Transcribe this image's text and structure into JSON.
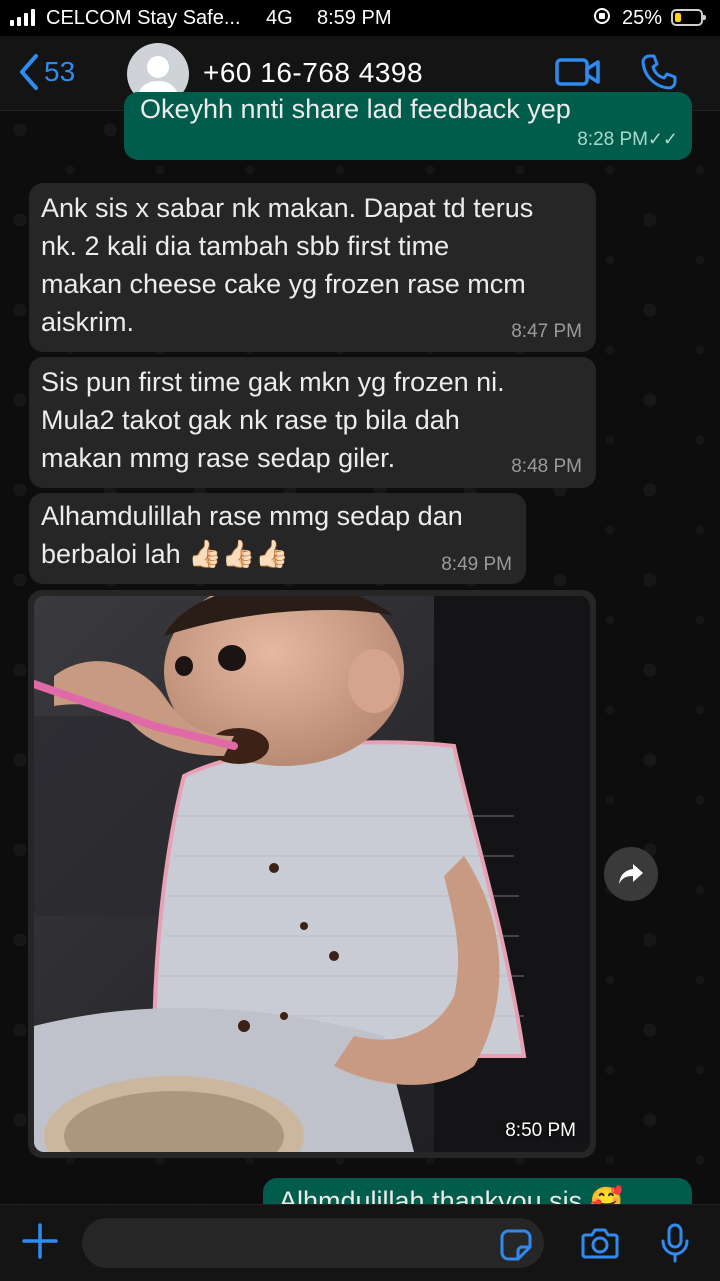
{
  "status_bar": {
    "carrier": "CELCOM Stay Safe...",
    "network": "4G",
    "time": "8:59 PM",
    "battery_percent": "25%",
    "battery_level": 0.25
  },
  "header": {
    "back_count": "53",
    "contact_name": "+60 16-768 4398",
    "accent_color": "#2f8bf0"
  },
  "messages": [
    {
      "direction": "outgoing",
      "text": "Okeyhh nnti share lad feedback yep",
      "time": "8:28 PM",
      "status": "read"
    },
    {
      "direction": "incoming",
      "text": "Ank sis x sabar nk makan. Dapat td terus\nnk. 2 kali dia tambah sbb first time\nmakan cheese cake yg frozen rase mcm\naiskrim.",
      "time": "8:47 PM"
    },
    {
      "direction": "incoming",
      "text": "Sis pun first time gak mkn yg frozen ni.\nMula2 takot gak nk rase tp bila dah\nmakan mmg rase sedap giler.",
      "time": "8:48 PM"
    },
    {
      "direction": "incoming",
      "text": "Alhamdulillah rase mmg sedap dan\nberbaloi lah 👍🏻👍🏻👍🏻",
      "time": "8:49 PM"
    },
    {
      "direction": "incoming",
      "type": "photo",
      "time": "8:50 PM"
    },
    {
      "direction": "outgoing",
      "text": "Alhmdulillah thankyou sis 🥰",
      "time": ""
    }
  ],
  "input": {
    "placeholder": ""
  },
  "colors": {
    "incoming_bubble": "#262626",
    "outgoing_bubble": "#005c4b",
    "background": "#0d0d0d"
  }
}
